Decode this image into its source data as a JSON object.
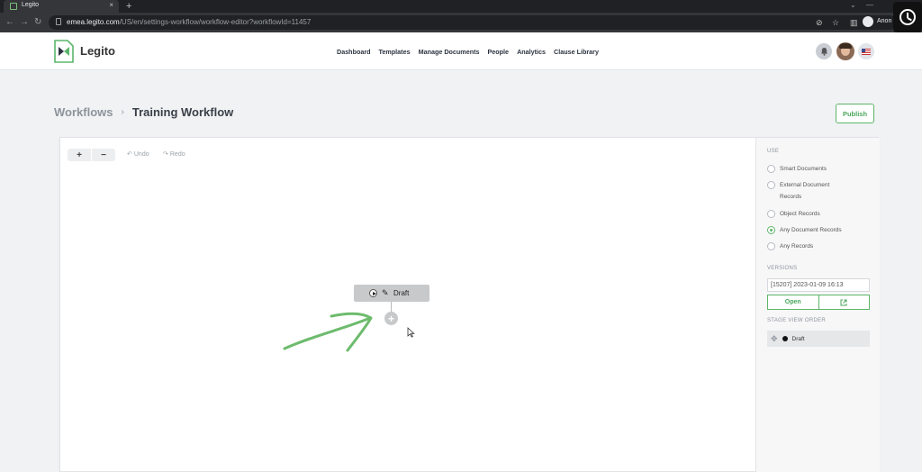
{
  "browser": {
    "tab_title": "Legito",
    "tab_close": "×",
    "new_tab": "+",
    "url_host": "emea.legito.com",
    "url_path": "/US/en/settings-workflow/workflow-editor?workflowId=11457",
    "profile_name": "Anon"
  },
  "header": {
    "logo_text": "Legito",
    "nav": [
      "Dashboard",
      "Templates",
      "Manage Documents",
      "People",
      "Analytics",
      "Clause Library"
    ]
  },
  "breadcrumb": {
    "root": "Workflows",
    "separator": "›",
    "current": "Training Workflow"
  },
  "publish_label": "Publish",
  "toolbar": {
    "zoom_in": "+",
    "zoom_out": "−",
    "undo": "Undo",
    "redo": "Redo"
  },
  "canvas": {
    "stage_label": "Draft",
    "add_stage": "+"
  },
  "sidebar": {
    "use_heading": "USE",
    "use_options": [
      {
        "label": "Smart Documents",
        "checked": false
      },
      {
        "label": "External Document Records",
        "checked": false
      },
      {
        "label": "Object Records",
        "checked": false
      },
      {
        "label": "Any Document Records",
        "checked": true
      },
      {
        "label": "Any Records",
        "checked": false
      }
    ],
    "versions_heading": "VERSIONS",
    "version_value": "[15207] 2023-01-09 16:13",
    "open_label": "Open",
    "stage_order_heading": "STAGE VIEW ORDER",
    "stage_order_items": [
      "Draft"
    ]
  },
  "colors": {
    "accent": "#5cb56a",
    "annotation_arrow": "#6dbb6d",
    "stage_node": "#c8c9cb"
  }
}
